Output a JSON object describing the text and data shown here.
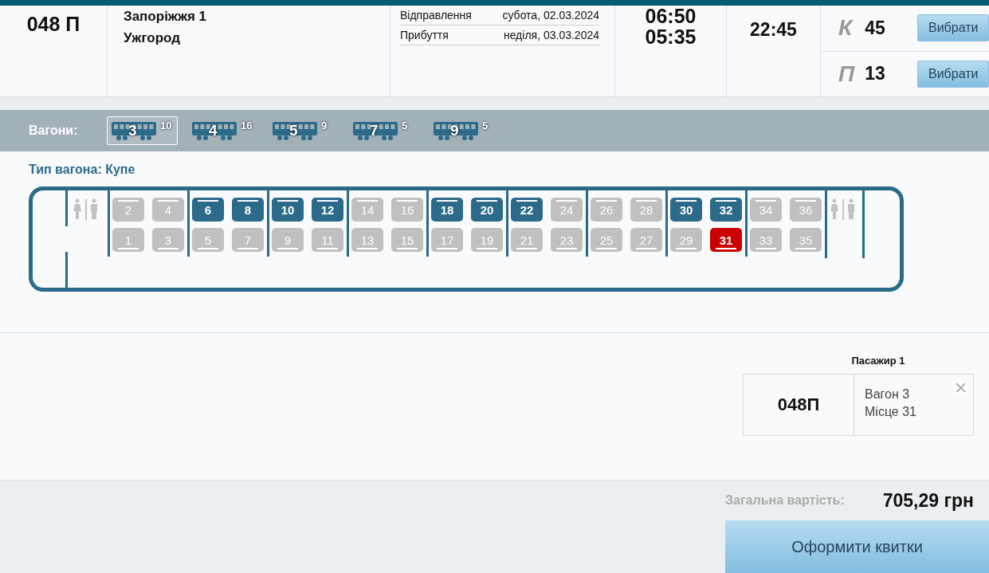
{
  "train": {
    "number": "048 П",
    "stations": [
      "Запоріжжя 1",
      "Ужгород"
    ],
    "schedule": [
      {
        "label": "Відправлення",
        "date": "субота, 02.03.2024"
      },
      {
        "label": "Прибуття",
        "date": "неділя, 03.03.2024"
      }
    ],
    "times": [
      "06:50",
      "05:35"
    ],
    "duration": "22:45",
    "classes": [
      {
        "letter": "К",
        "count": "45",
        "button": "Вибрати"
      },
      {
        "letter": "П",
        "count": "13",
        "button": "Вибрати"
      }
    ]
  },
  "wagons": {
    "label": "Вагони:",
    "items": [
      {
        "number": "3",
        "free": "10",
        "selected": true
      },
      {
        "number": "4",
        "free": "16",
        "selected": false
      },
      {
        "number": "5",
        "free": "9",
        "selected": false
      },
      {
        "number": "7",
        "free": "5",
        "selected": false
      },
      {
        "number": "9",
        "free": "5",
        "selected": false
      }
    ]
  },
  "wagon_type": "Тип вагона: Купе",
  "compartments": [
    {
      "upper": [
        {
          "number": "2",
          "available": false,
          "selected": false
        },
        {
          "number": "4",
          "available": false,
          "selected": false
        }
      ],
      "lower": [
        {
          "number": "1",
          "available": false,
          "selected": false
        },
        {
          "number": "3",
          "available": false,
          "selected": false
        }
      ]
    },
    {
      "upper": [
        {
          "number": "6",
          "available": true,
          "selected": false
        },
        {
          "number": "8",
          "available": true,
          "selected": false
        }
      ],
      "lower": [
        {
          "number": "5",
          "available": false,
          "selected": false
        },
        {
          "number": "7",
          "available": false,
          "selected": false
        }
      ]
    },
    {
      "upper": [
        {
          "number": "10",
          "available": true,
          "selected": false
        },
        {
          "number": "12",
          "available": true,
          "selected": false
        }
      ],
      "lower": [
        {
          "number": "9",
          "available": false,
          "selected": false
        },
        {
          "number": "11",
          "available": false,
          "selected": false
        }
      ]
    },
    {
      "upper": [
        {
          "number": "14",
          "available": false,
          "selected": false
        },
        {
          "number": "16",
          "available": false,
          "selected": false
        }
      ],
      "lower": [
        {
          "number": "13",
          "available": false,
          "selected": false
        },
        {
          "number": "15",
          "available": false,
          "selected": false
        }
      ]
    },
    {
      "upper": [
        {
          "number": "18",
          "available": true,
          "selected": false
        },
        {
          "number": "20",
          "available": true,
          "selected": false
        }
      ],
      "lower": [
        {
          "number": "17",
          "available": false,
          "selected": false
        },
        {
          "number": "19",
          "available": false,
          "selected": false
        }
      ]
    },
    {
      "upper": [
        {
          "number": "22",
          "available": true,
          "selected": false
        },
        {
          "number": "24",
          "available": false,
          "selected": false
        }
      ],
      "lower": [
        {
          "number": "21",
          "available": false,
          "selected": false
        },
        {
          "number": "23",
          "available": false,
          "selected": false
        }
      ]
    },
    {
      "upper": [
        {
          "number": "26",
          "available": false,
          "selected": false
        },
        {
          "number": "28",
          "available": false,
          "selected": false
        }
      ],
      "lower": [
        {
          "number": "25",
          "available": false,
          "selected": false
        },
        {
          "number": "27",
          "available": false,
          "selected": false
        }
      ]
    },
    {
      "upper": [
        {
          "number": "30",
          "available": true,
          "selected": false
        },
        {
          "number": "32",
          "available": true,
          "selected": false
        }
      ],
      "lower": [
        {
          "number": "29",
          "available": false,
          "selected": false
        },
        {
          "number": "31",
          "available": true,
          "selected": true
        }
      ]
    },
    {
      "upper": [
        {
          "number": "34",
          "available": false,
          "selected": false
        },
        {
          "number": "36",
          "available": false,
          "selected": false
        }
      ],
      "lower": [
        {
          "number": "33",
          "available": false,
          "selected": false
        },
        {
          "number": "35",
          "available": false,
          "selected": false
        }
      ]
    }
  ],
  "passenger": {
    "title": "Пасажир 1",
    "train": "048П",
    "lines": [
      "Вагон 3",
      "Місце 31"
    ]
  },
  "total": {
    "label": "Загальна вартість:",
    "amount": "705,29 грн"
  },
  "checkout_button": "Оформити квитки"
}
